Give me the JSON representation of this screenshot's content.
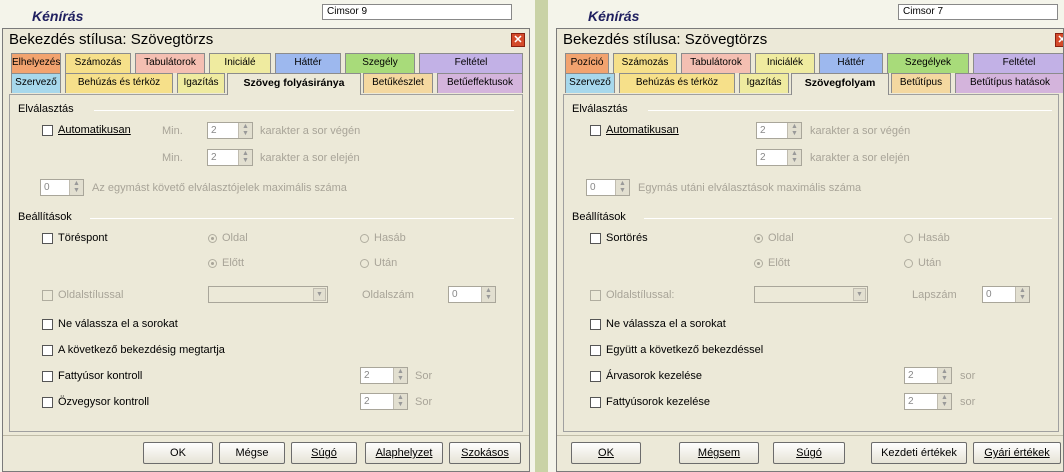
{
  "background": {
    "left_heading": "Kénírás",
    "left_style_box": "Cimsor 9",
    "right_heading": "Kénírás",
    "right_style_box": "Cimsor 7"
  },
  "left": {
    "title": "Bekezdés stílusa: Szövegtörzs",
    "tabs_row1": [
      "Elhelyezés",
      "Számozás",
      "Tabulátorok",
      "Iniciálé",
      "Háttér",
      "Szegély",
      "Feltétel"
    ],
    "tabs_row2": [
      "Szervező",
      "Behúzás és térköz",
      "Igazítás",
      "Szöveg folyásiránya",
      "Betűkészlet",
      "Betűeffektusok"
    ],
    "hyphen": {
      "group": "Elválasztás",
      "auto": "Automatikusan",
      "min1": "Min.",
      "val1": "2",
      "text1": "karakter a sor végén",
      "min2": "Min.",
      "val2": "2",
      "text2": "karakter a sor elején",
      "max_val": "0",
      "max_text": "Az egymást követő elválasztójelek maximális száma"
    },
    "settings": {
      "group": "Beállítások",
      "break": "Töréspont",
      "page": "Oldal",
      "column": "Hasáb",
      "before": "Előtt",
      "after": "Után",
      "pagestyle": "Oldalstílussal",
      "pagenum": "Oldalszám",
      "pagenum_val": "0",
      "keep_lines": "Ne válassza el a sorokat",
      "keep_next": "A következő bekezdésig megtartja",
      "orphan": "Fattyúsor kontroll",
      "orphan_val": "2",
      "orphan_unit": "Sor",
      "widow": "Özvegysor kontroll",
      "widow_val": "2",
      "widow_unit": "Sor"
    },
    "buttons": [
      "OK",
      "Mégse",
      "Súgó",
      "Alaphelyzet",
      "Szokásos"
    ]
  },
  "right": {
    "title": "Bekezdés stílusa: Szövegtörzs",
    "tabs_row1": [
      "Pozíció",
      "Számozás",
      "Tabulátorok",
      "Iniciálék",
      "Háttér",
      "Szegélyek",
      "Feltétel"
    ],
    "tabs_row2": [
      "Szervező",
      "Behúzás és térköz",
      "Igazítás",
      "Szövegfolyam",
      "Betűtípus",
      "Betűtípus hatások"
    ],
    "hyphen": {
      "group": "Elválasztás",
      "auto": "Automatikusan",
      "val1": "2",
      "text1": "karakter a sor végén",
      "val2": "2",
      "text2": "karakter a sor elején",
      "max_val": "0",
      "max_text": "Egymás utáni elválasztások maximális száma"
    },
    "settings": {
      "group": "Beállítások",
      "break": "Sortörés",
      "page": "Oldal",
      "column": "Hasáb",
      "before": "Előtt",
      "after": "Után",
      "pagestyle": "Oldalstílussal:",
      "pagenum": "Lapszám",
      "pagenum_val": "0",
      "keep_lines": "Ne válassza el a sorokat",
      "keep_next": "Együtt a következő bekezdéssel",
      "orphan": "Árvasorok kezelése",
      "orphan_val": "2",
      "orphan_unit": "sor",
      "widow": "Fattyúsorok kezelése",
      "widow_val": "2",
      "widow_unit": "sor"
    },
    "buttons": [
      "OK",
      "Mégsem",
      "Súgó",
      "Kezdeti értékek",
      "Gyári értékek"
    ]
  },
  "colors": {
    "tab_palette": [
      "#f2a36f",
      "#f6e08a",
      "#f4bfb2",
      "#efeba0",
      "#9db8ee",
      "#a8db7a",
      "#c2b1e6"
    ],
    "tab_palette2": [
      "#a7d8ec",
      "#f6e08a",
      "#efeba0",
      "#ece9d8",
      "#f4d8a0",
      "#d4b4dc"
    ]
  }
}
